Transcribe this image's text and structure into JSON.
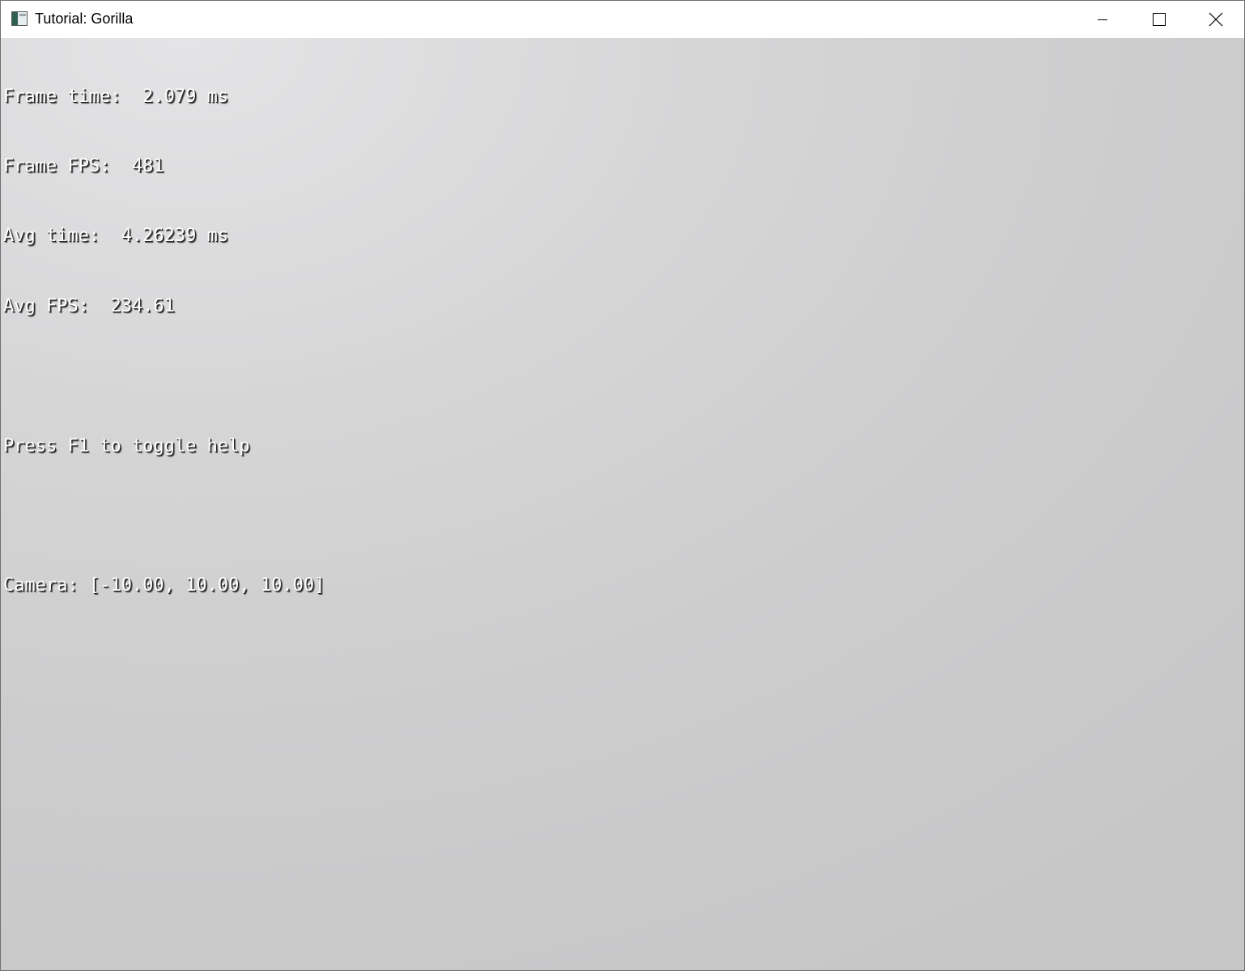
{
  "window": {
    "title": "Tutorial: Gorilla",
    "icons": {
      "app": "app-window-icon",
      "minimize": "minimize-icon",
      "maximize": "maximize-icon",
      "close": "close-icon"
    }
  },
  "overlay": {
    "frame_time": "Frame time:  2.079 ms",
    "frame_fps": "Frame FPS:  481",
    "avg_time": "Avg time:  4.26239 ms",
    "avg_fps": "Avg FPS:  234.61",
    "help_hint": "Press F1 to toggle help",
    "camera": "Camera: [-10.00, 10.00, 10.00]"
  },
  "colors": {
    "text": "#ffffff",
    "text_shadow": "#222222",
    "background_light": "#e4e4e6",
    "background_dark": "#c7c7c8"
  }
}
